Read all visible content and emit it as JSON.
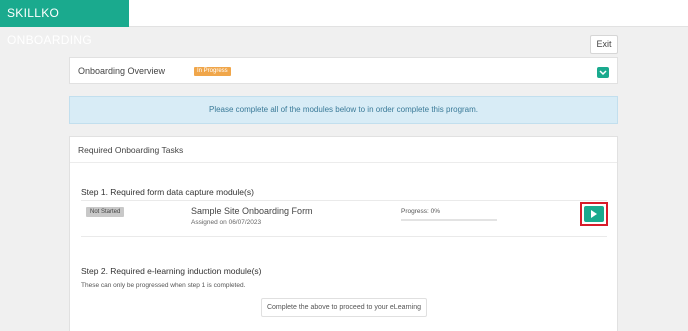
{
  "brand": {
    "title": "SKILLKO ONBOARDING"
  },
  "header": {
    "exit_label": "Exit"
  },
  "overview": {
    "title": "Onboarding Overview",
    "status": "In Progress",
    "toggle_icon": "chevron-down-icon"
  },
  "info_banner": {
    "text": "Please complete all of the modules below to in order complete this program."
  },
  "tasks": {
    "title": "Required Onboarding Tasks",
    "step1": {
      "heading": "Step 1. Required form data capture module(s)",
      "module": {
        "status": "Not Started",
        "title": "Sample Site Onboarding Form",
        "assigned": "Assigned on 06/07/2023",
        "progress_label": "Progress: 0%",
        "progress_value": 0,
        "action_icon": "play-icon"
      }
    },
    "step2": {
      "heading": "Step 2. Required e-learning induction module(s)",
      "note": "These can only be progressed when step 1 is completed.",
      "proceed_text": "Complete the above to proceed to your eLearning"
    }
  },
  "colors": {
    "brand": "#1aaa8e",
    "in_progress": "#f0a64a",
    "info_bg": "#d8ecf6",
    "highlight": "#d81b2a"
  }
}
